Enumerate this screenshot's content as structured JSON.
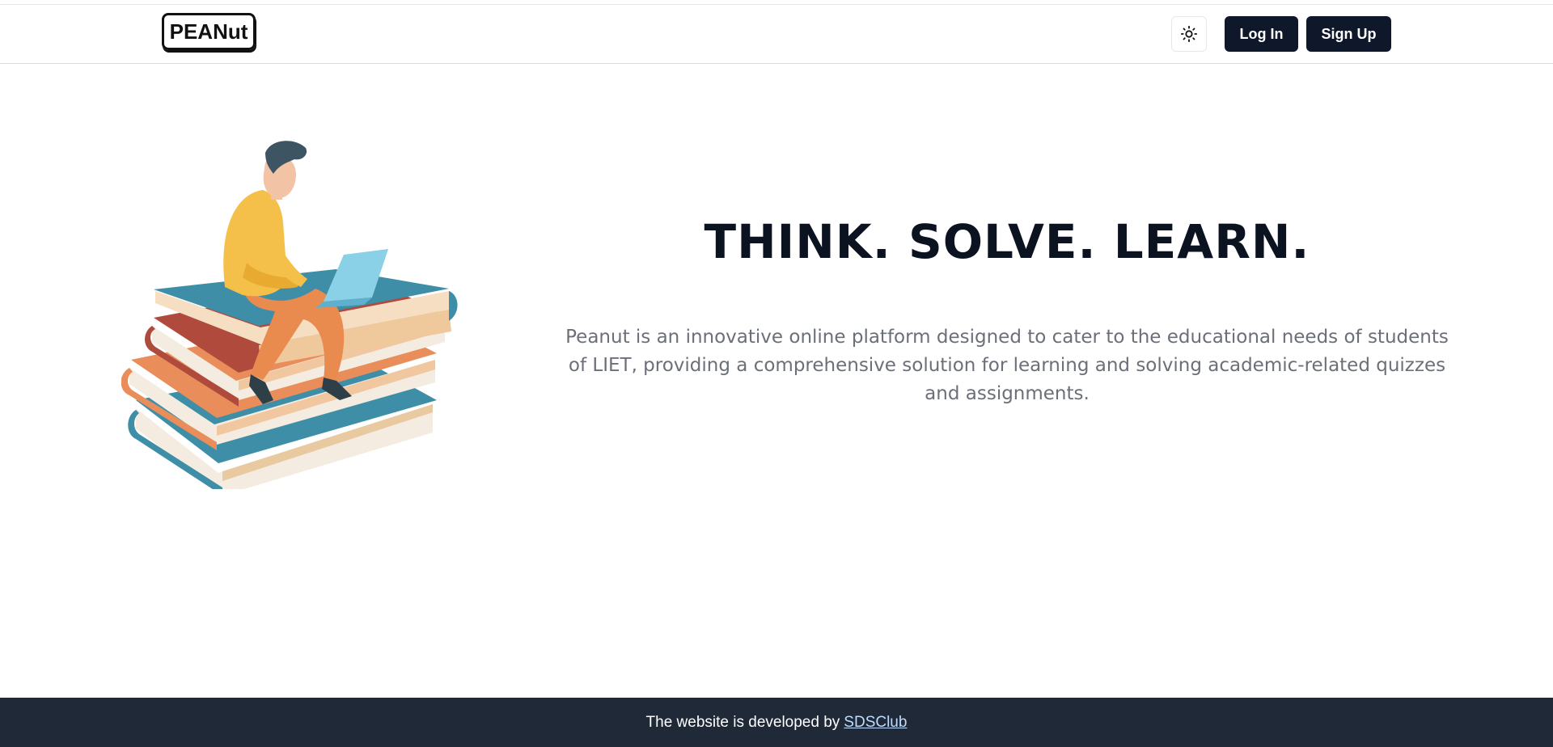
{
  "navbar": {
    "logo_text": "PEANut",
    "theme_toggle_icon": "sun-icon",
    "login_label": "Log In",
    "signup_label": "Sign Up"
  },
  "hero": {
    "title": "THINK. SOLVE. LEARN.",
    "description": "Peanut is an innovative online platform designed to cater to the educational needs of students of LIET, providing a comprehensive solution for learning and solving academic-related quizzes and assignments.",
    "illustration_icon": "student-on-books-illustration"
  },
  "footer": {
    "text": "The website is developed by",
    "link_text": "SDSClub"
  },
  "colors": {
    "primary_button": "#0f172a",
    "title": "#0b1220",
    "body_text": "#6b6f78",
    "footer_bg": "#1f2937",
    "footer_link": "#bfdbfe"
  }
}
